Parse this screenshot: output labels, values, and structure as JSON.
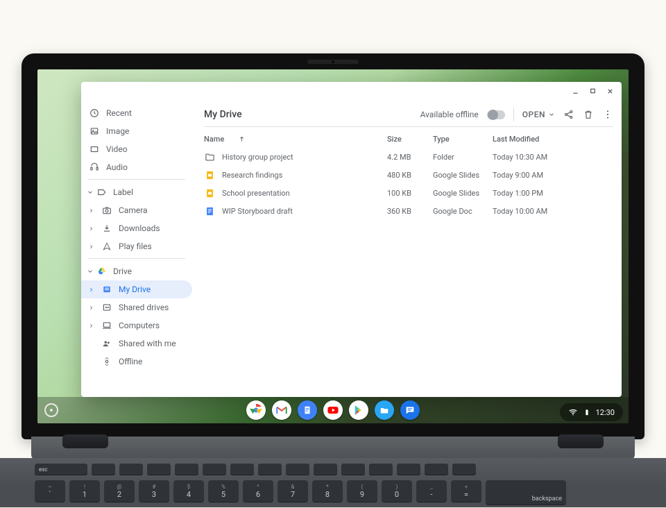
{
  "sidebar": {
    "recent": {
      "label": "Recent"
    },
    "image": {
      "label": "Image"
    },
    "video": {
      "label": "Video"
    },
    "audio": {
      "label": "Audio"
    },
    "labelCat": {
      "label": "Label"
    },
    "camera": {
      "label": "Camera"
    },
    "downloads": {
      "label": "Downloads"
    },
    "playfiles": {
      "label": "Play files"
    },
    "driveCat": {
      "label": "Drive"
    },
    "mydrive": {
      "label": "My Drive"
    },
    "shareddrv": {
      "label": "Shared drives"
    },
    "computers": {
      "label": "Computers"
    },
    "sharedwme": {
      "label": "Shared with me"
    },
    "offline": {
      "label": "Offline"
    }
  },
  "header": {
    "title": "My Drive",
    "offline_label": "Available offline",
    "open_label": "OPEN"
  },
  "columns": {
    "name": "Name",
    "size": "Size",
    "type": "Type",
    "modified": "Last Modified"
  },
  "files": [
    {
      "name": "History group project",
      "size": "4.2 MB",
      "type": "Folder",
      "modified": "Today 10:30 AM",
      "icon": "folder"
    },
    {
      "name": "Research findings",
      "size": "480 KB",
      "type": "Google Slides",
      "modified": "Today 9:00 AM",
      "icon": "slides"
    },
    {
      "name": "School presentation",
      "size": "100 KB",
      "type": "Google Slides",
      "modified": "Today 1:00 PM",
      "icon": "slides"
    },
    {
      "name": "WIP Storyboard draft",
      "size": "360 KB",
      "type": "Google Doc",
      "modified": "Today 10:00 AM",
      "icon": "doc"
    }
  ],
  "clock": "12:30",
  "keyboard": {
    "funcrow": [
      "esc",
      "",
      "",
      "",
      "",
      "",
      "",
      "",
      "",
      "",
      "",
      "",
      "",
      "",
      ""
    ],
    "numrow": [
      {
        "n": "1",
        "s": "!"
      },
      {
        "n": "2",
        "s": "@"
      },
      {
        "n": "3",
        "s": "#"
      },
      {
        "n": "4",
        "s": "$"
      },
      {
        "n": "5",
        "s": "%"
      },
      {
        "n": "6",
        "s": "^"
      },
      {
        "n": "7",
        "s": "&"
      },
      {
        "n": "8",
        "s": "*"
      },
      {
        "n": "9",
        "s": "("
      },
      {
        "n": "0",
        "s": ")"
      },
      {
        "n": "-",
        "s": "_"
      },
      {
        "n": "=",
        "s": "+"
      }
    ],
    "backspace": "backspace"
  }
}
